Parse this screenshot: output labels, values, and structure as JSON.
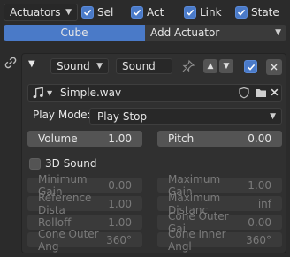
{
  "header": {
    "type_select": "Actuators",
    "filters": [
      {
        "label": "Sel",
        "checked": true
      },
      {
        "label": "Act",
        "checked": true
      },
      {
        "label": "Link",
        "checked": true
      },
      {
        "label": "State",
        "checked": true
      }
    ]
  },
  "tabs": {
    "active": "Cube",
    "add": "Add Actuator"
  },
  "actuator": {
    "type": "Sound",
    "name": "Sound",
    "sound_file": "Simple.wav",
    "play_mode_label": "Play Mode:",
    "play_mode_value": "Play Stop",
    "volume_label": "Volume",
    "volume_value": "1.00",
    "pitch_label": "Pitch",
    "pitch_value": "0.00",
    "sound3d_label": "3D Sound",
    "sound3d_checked": false,
    "params": [
      {
        "label": "Minimum Gain",
        "value": "0.00"
      },
      {
        "label": "Maximum Gain",
        "value": "1.00"
      },
      {
        "label": "Reference Dista",
        "value": "1.00"
      },
      {
        "label": "Maximum Distanc",
        "value": "inf"
      },
      {
        "label": "Rolloff",
        "value": "1.00"
      },
      {
        "label": "Cone Outer Gai",
        "value": "0.00"
      },
      {
        "label": "Cone Outer Ang",
        "value": "360°"
      },
      {
        "label": "Cone Inner Angl",
        "value": "360°"
      }
    ]
  }
}
